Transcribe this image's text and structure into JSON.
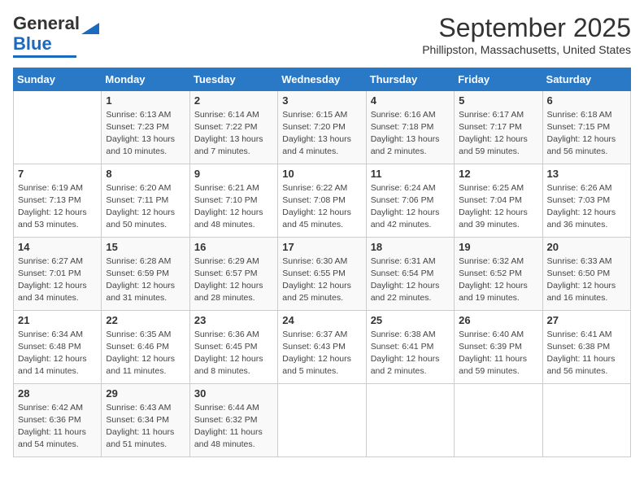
{
  "logo": {
    "line1": "General",
    "line2": "Blue"
  },
  "title": "September 2025",
  "location": "Phillipston, Massachusetts, United States",
  "headers": [
    "Sunday",
    "Monday",
    "Tuesday",
    "Wednesday",
    "Thursday",
    "Friday",
    "Saturday"
  ],
  "weeks": [
    [
      {
        "day": "",
        "sunrise": "",
        "sunset": "",
        "daylight": ""
      },
      {
        "day": "1",
        "sunrise": "Sunrise: 6:13 AM",
        "sunset": "Sunset: 7:23 PM",
        "daylight": "Daylight: 13 hours and 10 minutes."
      },
      {
        "day": "2",
        "sunrise": "Sunrise: 6:14 AM",
        "sunset": "Sunset: 7:22 PM",
        "daylight": "Daylight: 13 hours and 7 minutes."
      },
      {
        "day": "3",
        "sunrise": "Sunrise: 6:15 AM",
        "sunset": "Sunset: 7:20 PM",
        "daylight": "Daylight: 13 hours and 4 minutes."
      },
      {
        "day": "4",
        "sunrise": "Sunrise: 6:16 AM",
        "sunset": "Sunset: 7:18 PM",
        "daylight": "Daylight: 13 hours and 2 minutes."
      },
      {
        "day": "5",
        "sunrise": "Sunrise: 6:17 AM",
        "sunset": "Sunset: 7:17 PM",
        "daylight": "Daylight: 12 hours and 59 minutes."
      },
      {
        "day": "6",
        "sunrise": "Sunrise: 6:18 AM",
        "sunset": "Sunset: 7:15 PM",
        "daylight": "Daylight: 12 hours and 56 minutes."
      }
    ],
    [
      {
        "day": "7",
        "sunrise": "Sunrise: 6:19 AM",
        "sunset": "Sunset: 7:13 PM",
        "daylight": "Daylight: 12 hours and 53 minutes."
      },
      {
        "day": "8",
        "sunrise": "Sunrise: 6:20 AM",
        "sunset": "Sunset: 7:11 PM",
        "daylight": "Daylight: 12 hours and 50 minutes."
      },
      {
        "day": "9",
        "sunrise": "Sunrise: 6:21 AM",
        "sunset": "Sunset: 7:10 PM",
        "daylight": "Daylight: 12 hours and 48 minutes."
      },
      {
        "day": "10",
        "sunrise": "Sunrise: 6:22 AM",
        "sunset": "Sunset: 7:08 PM",
        "daylight": "Daylight: 12 hours and 45 minutes."
      },
      {
        "day": "11",
        "sunrise": "Sunrise: 6:24 AM",
        "sunset": "Sunset: 7:06 PM",
        "daylight": "Daylight: 12 hours and 42 minutes."
      },
      {
        "day": "12",
        "sunrise": "Sunrise: 6:25 AM",
        "sunset": "Sunset: 7:04 PM",
        "daylight": "Daylight: 12 hours and 39 minutes."
      },
      {
        "day": "13",
        "sunrise": "Sunrise: 6:26 AM",
        "sunset": "Sunset: 7:03 PM",
        "daylight": "Daylight: 12 hours and 36 minutes."
      }
    ],
    [
      {
        "day": "14",
        "sunrise": "Sunrise: 6:27 AM",
        "sunset": "Sunset: 7:01 PM",
        "daylight": "Daylight: 12 hours and 34 minutes."
      },
      {
        "day": "15",
        "sunrise": "Sunrise: 6:28 AM",
        "sunset": "Sunset: 6:59 PM",
        "daylight": "Daylight: 12 hours and 31 minutes."
      },
      {
        "day": "16",
        "sunrise": "Sunrise: 6:29 AM",
        "sunset": "Sunset: 6:57 PM",
        "daylight": "Daylight: 12 hours and 28 minutes."
      },
      {
        "day": "17",
        "sunrise": "Sunrise: 6:30 AM",
        "sunset": "Sunset: 6:55 PM",
        "daylight": "Daylight: 12 hours and 25 minutes."
      },
      {
        "day": "18",
        "sunrise": "Sunrise: 6:31 AM",
        "sunset": "Sunset: 6:54 PM",
        "daylight": "Daylight: 12 hours and 22 minutes."
      },
      {
        "day": "19",
        "sunrise": "Sunrise: 6:32 AM",
        "sunset": "Sunset: 6:52 PM",
        "daylight": "Daylight: 12 hours and 19 minutes."
      },
      {
        "day": "20",
        "sunrise": "Sunrise: 6:33 AM",
        "sunset": "Sunset: 6:50 PM",
        "daylight": "Daylight: 12 hours and 16 minutes."
      }
    ],
    [
      {
        "day": "21",
        "sunrise": "Sunrise: 6:34 AM",
        "sunset": "Sunset: 6:48 PM",
        "daylight": "Daylight: 12 hours and 14 minutes."
      },
      {
        "day": "22",
        "sunrise": "Sunrise: 6:35 AM",
        "sunset": "Sunset: 6:46 PM",
        "daylight": "Daylight: 12 hours and 11 minutes."
      },
      {
        "day": "23",
        "sunrise": "Sunrise: 6:36 AM",
        "sunset": "Sunset: 6:45 PM",
        "daylight": "Daylight: 12 hours and 8 minutes."
      },
      {
        "day": "24",
        "sunrise": "Sunrise: 6:37 AM",
        "sunset": "Sunset: 6:43 PM",
        "daylight": "Daylight: 12 hours and 5 minutes."
      },
      {
        "day": "25",
        "sunrise": "Sunrise: 6:38 AM",
        "sunset": "Sunset: 6:41 PM",
        "daylight": "Daylight: 12 hours and 2 minutes."
      },
      {
        "day": "26",
        "sunrise": "Sunrise: 6:40 AM",
        "sunset": "Sunset: 6:39 PM",
        "daylight": "Daylight: 11 hours and 59 minutes."
      },
      {
        "day": "27",
        "sunrise": "Sunrise: 6:41 AM",
        "sunset": "Sunset: 6:38 PM",
        "daylight": "Daylight: 11 hours and 56 minutes."
      }
    ],
    [
      {
        "day": "28",
        "sunrise": "Sunrise: 6:42 AM",
        "sunset": "Sunset: 6:36 PM",
        "daylight": "Daylight: 11 hours and 54 minutes."
      },
      {
        "day": "29",
        "sunrise": "Sunrise: 6:43 AM",
        "sunset": "Sunset: 6:34 PM",
        "daylight": "Daylight: 11 hours and 51 minutes."
      },
      {
        "day": "30",
        "sunrise": "Sunrise: 6:44 AM",
        "sunset": "Sunset: 6:32 PM",
        "daylight": "Daylight: 11 hours and 48 minutes."
      },
      {
        "day": "",
        "sunrise": "",
        "sunset": "",
        "daylight": ""
      },
      {
        "day": "",
        "sunrise": "",
        "sunset": "",
        "daylight": ""
      },
      {
        "day": "",
        "sunrise": "",
        "sunset": "",
        "daylight": ""
      },
      {
        "day": "",
        "sunrise": "",
        "sunset": "",
        "daylight": ""
      }
    ]
  ]
}
